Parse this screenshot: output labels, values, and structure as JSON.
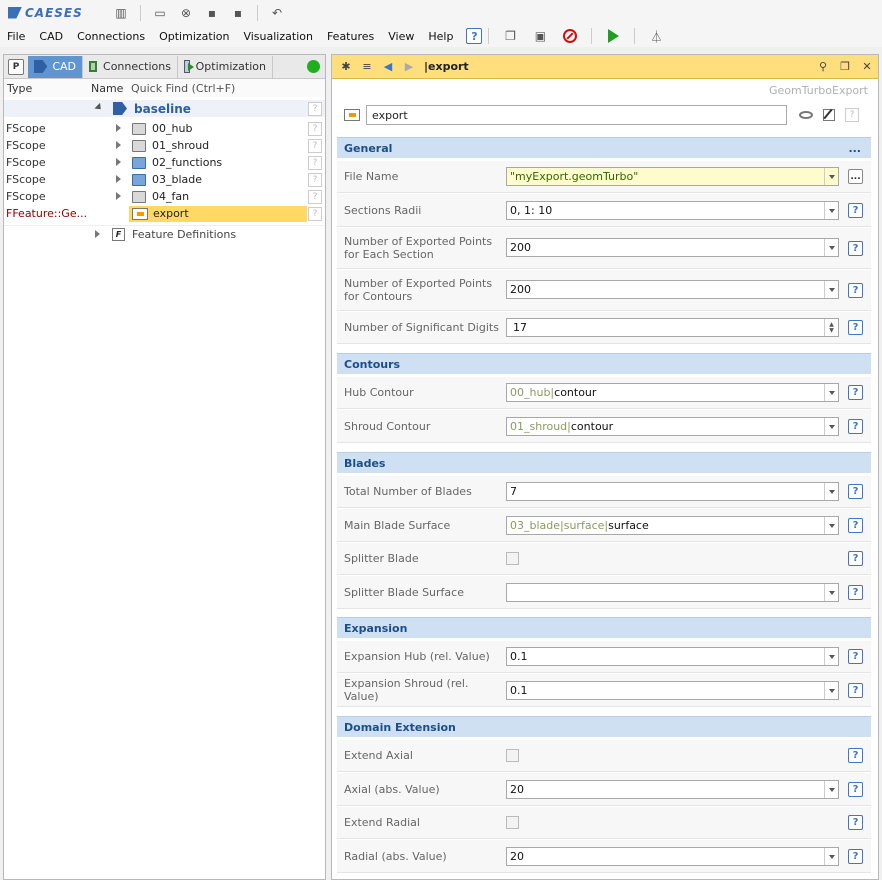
{
  "app": {
    "logo_text": "CAESES"
  },
  "menu": {
    "items": [
      "File",
      "CAD",
      "Connections",
      "Optimization",
      "Visualization",
      "Features",
      "View",
      "Help"
    ],
    "help_label": "?"
  },
  "left": {
    "p_label": "P",
    "tabs": [
      {
        "label": "CAD"
      },
      {
        "label": "Connections"
      },
      {
        "label": "Optimization"
      }
    ],
    "columns": {
      "type": "Type",
      "name": "Name",
      "quickfind": "Quick Find (Ctrl+F)"
    },
    "tree": {
      "baseline": "baseline",
      "items": [
        {
          "type": "FScope",
          "name": "00_hub"
        },
        {
          "type": "FScope",
          "name": "01_shroud"
        },
        {
          "type": "FScope",
          "name": "02_functions"
        },
        {
          "type": "FScope",
          "name": "03_blade"
        },
        {
          "type": "FScope",
          "name": "04_fan"
        },
        {
          "type": "FFeature::Ge...",
          "name": "export"
        }
      ],
      "feature_definitions": "Feature Definitions",
      "fd_icon": "F",
      "q": "?"
    }
  },
  "right": {
    "header_title": "|export",
    "subtitle": "GeomTurboExport",
    "name_value": "export",
    "q": "?",
    "dots": "...",
    "sections": {
      "general": "General",
      "contours": "Contours",
      "blades": "Blades",
      "expansion": "Expansion",
      "domain": "Domain Extension"
    },
    "props": {
      "file_name": {
        "label": "File Name",
        "value": "\"myExport.geomTurbo\""
      },
      "sections_radii": {
        "label": "Sections Radii",
        "value": "0, 1: 10"
      },
      "points_section": {
        "label": "Number of Exported Points for Each Section",
        "value": "200"
      },
      "points_contours": {
        "label": "Number of Exported Points for Contours",
        "value": "200"
      },
      "sig_digits": {
        "label": "Number of Significant Digits",
        "value": "17"
      },
      "hub_contour": {
        "label": "Hub Contour",
        "ref": "00_hub|",
        "value": "contour"
      },
      "shroud_contour": {
        "label": "Shroud Contour",
        "ref": "01_shroud|",
        "value": "contour"
      },
      "total_blades": {
        "label": "Total Number of Blades",
        "value": "7"
      },
      "main_blade": {
        "label": "Main Blade Surface",
        "ref": "03_blade|surface|",
        "value": "surface"
      },
      "splitter_blade": {
        "label": "Splitter Blade"
      },
      "splitter_surface": {
        "label": "Splitter Blade Surface",
        "value": ""
      },
      "exp_hub": {
        "label": "Expansion Hub (rel. Value)",
        "value": "0.1"
      },
      "exp_shroud": {
        "label": "Expansion Shroud (rel. Value)",
        "value": "0.1"
      },
      "extend_axial": {
        "label": "Extend Axial"
      },
      "axial_abs": {
        "label": "Axial (abs. Value)",
        "value": "20"
      },
      "extend_radial": {
        "label": "Extend Radial"
      },
      "radial_abs": {
        "label": "Radial (abs. Value)",
        "value": "20"
      }
    }
  }
}
